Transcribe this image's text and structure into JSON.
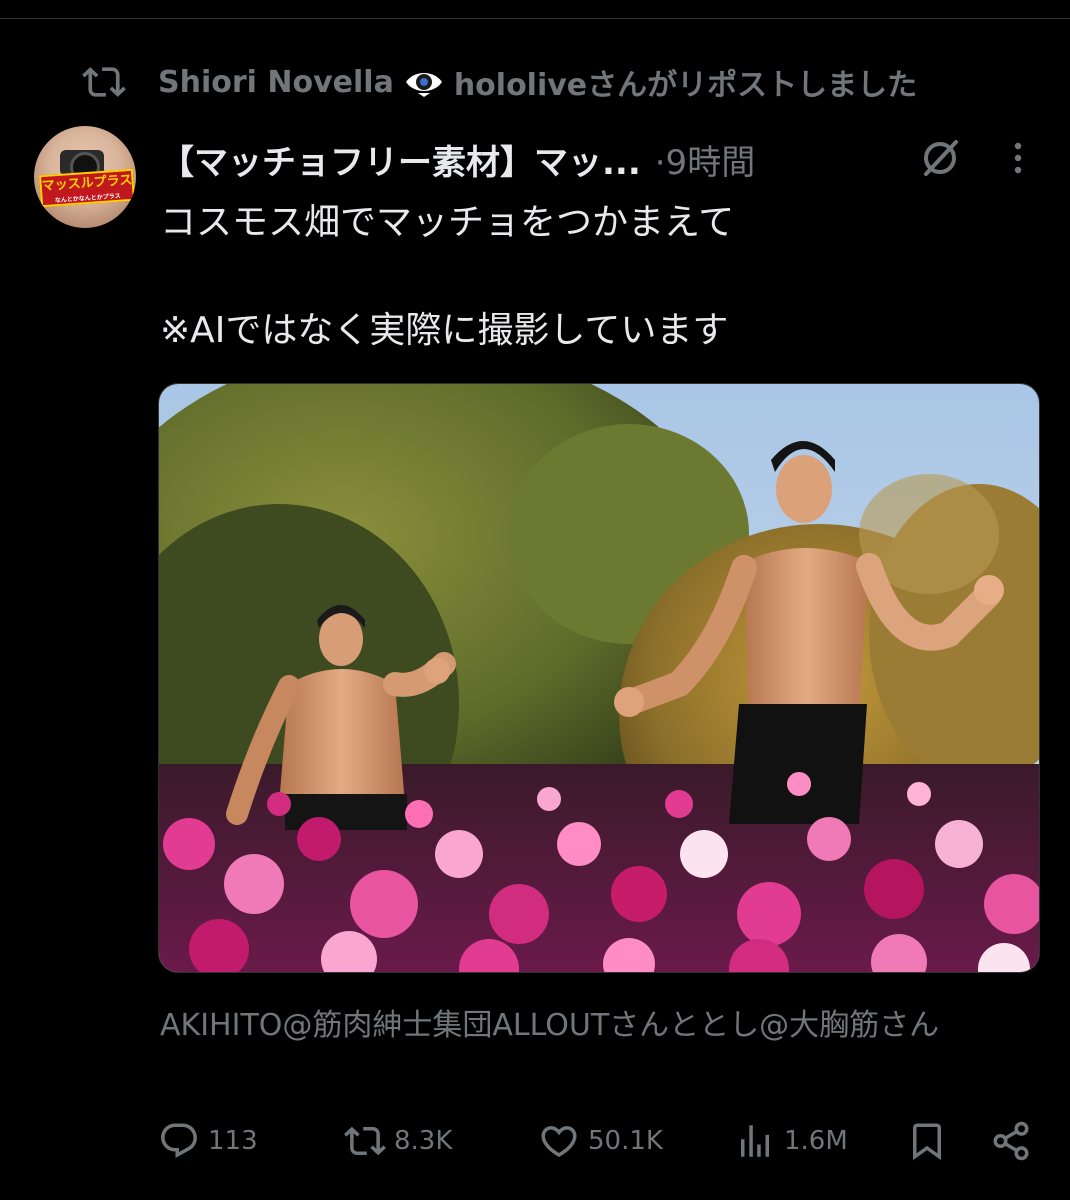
{
  "repost_banner": {
    "user": "Shiori Novella",
    "source": "hololiveさんがリポストしました",
    "icon": "repost-icon"
  },
  "post": {
    "display_name": "【マッチョフリー素材】マッ...",
    "time": "·9時間",
    "text_line1": "コスモス畑でマッチョをつかまえて",
    "text_line2": "※AIではなく実際に撮影しています",
    "avatar_banner": "マッスルプラス",
    "avatar_banner_sub": "なんとかなんとかプラス"
  },
  "caption": "AKIHITO@筋肉紳士集団ALLOUTさんととし@大胸筋さん",
  "actions": {
    "replies": "113",
    "reposts": "8.3K",
    "likes": "50.1K",
    "views": "1.6M"
  },
  "colors": {
    "background": "#000000",
    "text": "#e7e9ea",
    "muted": "#71767b"
  }
}
